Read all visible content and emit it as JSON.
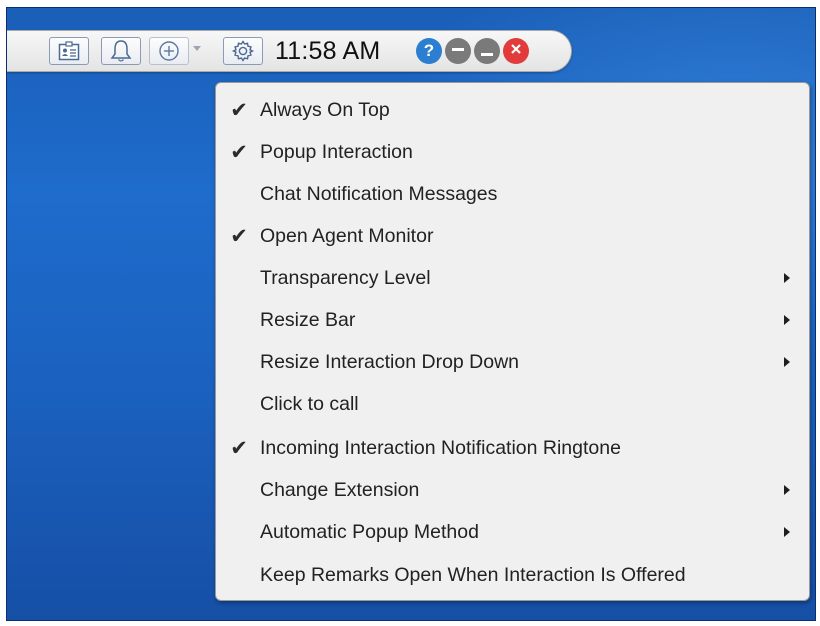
{
  "taskbar": {
    "clock": "11:58 AM",
    "icons": [
      "contact-card-icon",
      "bell-icon",
      "add-circle-icon",
      "gear-icon"
    ],
    "window_controls": [
      {
        "name": "help-icon",
        "glyph": "?",
        "color": "#2c7fd0"
      },
      {
        "name": "minimize-icon",
        "glyph": "—",
        "color": "#7a7a7a"
      },
      {
        "name": "restore-icon",
        "glyph": "—",
        "color": "#7a7a7a"
      },
      {
        "name": "close-icon",
        "glyph": "✕",
        "color": "#e23b3b"
      }
    ]
  },
  "menu": {
    "items": [
      {
        "label": "Always On Top",
        "checked": true,
        "submenu": false
      },
      {
        "label": "Popup Interaction",
        "checked": true,
        "submenu": false
      },
      {
        "label": "Chat Notification Messages",
        "checked": false,
        "submenu": false
      },
      {
        "label": "Open Agent Monitor",
        "checked": true,
        "submenu": false
      },
      {
        "label": "Transparency Level",
        "checked": false,
        "submenu": true
      },
      {
        "label": "Resize Bar",
        "checked": false,
        "submenu": true
      },
      {
        "label": "Resize Interaction Drop Down",
        "checked": false,
        "submenu": true
      },
      {
        "label": "Click to call",
        "checked": false,
        "submenu": false
      },
      {
        "label": "Incoming Interaction Notification Ringtone",
        "checked": true,
        "submenu": false
      },
      {
        "label": "Change Extension",
        "checked": false,
        "submenu": true
      },
      {
        "label": "Automatic Popup Method",
        "checked": false,
        "submenu": true
      },
      {
        "label": "Keep Remarks Open When Interaction Is Offered",
        "checked": false,
        "submenu": false
      }
    ],
    "check_glyph": "✔"
  },
  "colors": {
    "desktop": "#1b62c0",
    "menu_bg": "#f0f0f0",
    "help": "#2c7fd0",
    "close": "#e23b3b",
    "gray_control": "#7a7a7a"
  }
}
